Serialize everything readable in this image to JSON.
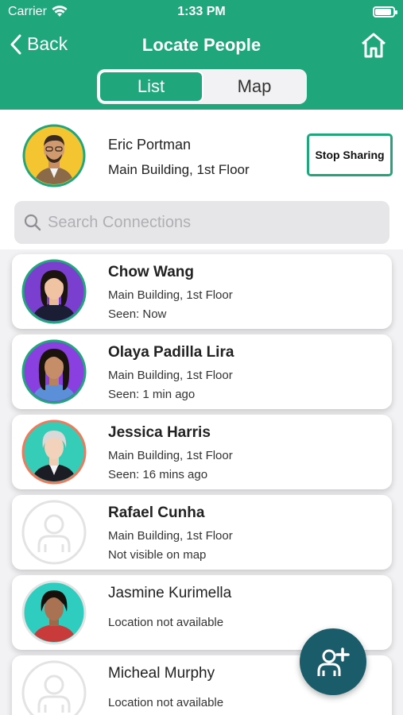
{
  "status_bar": {
    "carrier": "Carrier",
    "time": "1:33 PM"
  },
  "nav": {
    "back_label": "Back",
    "title": "Locate People"
  },
  "segments": [
    {
      "label": "List",
      "active": true
    },
    {
      "label": "Map",
      "active": false
    }
  ],
  "me": {
    "name": "Eric Portman",
    "location": "Main Building, 1st Floor",
    "stop_button": "Stop Sharing"
  },
  "search": {
    "placeholder": "Search Connections",
    "value": ""
  },
  "connections": [
    {
      "name": "Chow Wang",
      "line1": "Main Building, 1st Floor",
      "line2": "Seen: Now",
      "ring": "#1fa77b",
      "bg": "#7b3fd0"
    },
    {
      "name": "Olaya Padilla Lira",
      "line1": "Main Building, 1st Floor",
      "line2": "Seen: 1 min ago",
      "ring": "#1fa77b",
      "bg": "#8a3fe0"
    },
    {
      "name": "Jessica Harris",
      "line1": "Main Building, 1st Floor",
      "line2": "Seen: 16 mins ago",
      "ring": "#f0795b",
      "bg": "#36cdb8"
    },
    {
      "name": "Rafael Cunha",
      "line1": "Main Building, 1st Floor",
      "line2": "Not visible on map",
      "ring": "#e0e0e0",
      "bg": "#ffffff"
    },
    {
      "name": "Jasmine Kurimella",
      "line1": "Location not available",
      "ring": "#e0e0e0",
      "bg": "#2fcdc0"
    },
    {
      "name": "Micheal Murphy",
      "line1": "Location not available",
      "ring": "#e0e0e0",
      "bg": "#ffffff"
    }
  ],
  "colors": {
    "brand": "#1fa77b",
    "fab": "#1b5c6b"
  },
  "icons": {
    "fab": "add-person-icon",
    "home": "home-icon",
    "back": "chevron-left-icon",
    "search": "search-icon"
  }
}
